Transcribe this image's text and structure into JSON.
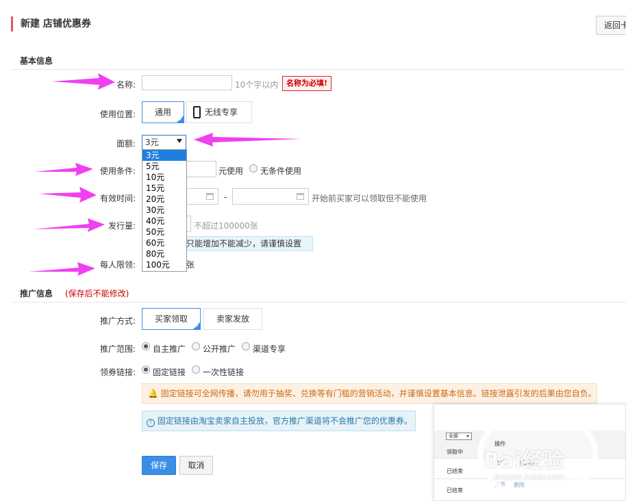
{
  "header": {
    "title": "新建 店铺优惠券",
    "back_label": "返回卡"
  },
  "basic_section": {
    "title": "基本信息"
  },
  "name_field": {
    "label": "名称:",
    "value": "",
    "hint": "10个字以内",
    "error": "名称为必填!"
  },
  "location_field": {
    "label": "使用位置:",
    "options": [
      "通用",
      "无线专享"
    ]
  },
  "amount_field": {
    "label": "面额:",
    "selected": "3元",
    "options": [
      "3元",
      "5元",
      "10元",
      "15元",
      "20元",
      "30元",
      "40元",
      "50元",
      "60元",
      "80元",
      "100元"
    ]
  },
  "condition_field": {
    "label": "使用条件:",
    "unit": "元使用",
    "no_condition": "无条件使用"
  },
  "validity_field": {
    "label": "有效时间:",
    "separator": "-",
    "hint": "开始前买家可以领取但不能使用"
  },
  "quantity_field": {
    "label": "发行量:",
    "hint": "不超过100000张",
    "note": "时只能增加不能减少，请谨慎设置"
  },
  "limit_field": {
    "label": "每人限领:",
    "unit": "张"
  },
  "promo_section": {
    "title": "推广信息",
    "note": "(保存后不能修改)"
  },
  "promo_method": {
    "label": "推广方式:",
    "options": [
      "买家领取",
      "卖家发放"
    ]
  },
  "promo_scope": {
    "label": "推广范围:",
    "options": [
      "自主推广",
      "公开推广",
      "渠道专享"
    ]
  },
  "coupon_link": {
    "label": "领券链接:",
    "options": [
      "固定链接",
      "一次性链接"
    ]
  },
  "notices": {
    "warning": "固定链接可全网传播，请勿用于抽奖、兑换等有门槛的营销活动，并谨慎设置基本信息。链接泄露引发的后果由您自负。",
    "info": "固定链接由淘宝卖家自主投放，官方推广渠道将不会推广您的优惠券。"
  },
  "actions": {
    "save": "保存",
    "cancel": "取消"
  },
  "preview": {
    "filter": "全部",
    "col_header": "操作",
    "rows": [
      {
        "status": "领取中",
        "actions": [
          "管理",
          "查看链接"
        ]
      },
      {
        "status": "已结束",
        "actions": [
          "查看",
          "删除"
        ]
      },
      {
        "status": "已结束",
        "actions": [
          "查看",
          "删除"
        ]
      }
    ]
  },
  "watermark": {
    "brand": "Bai经验",
    "url": "jingyan.baidu.com"
  },
  "colors": {
    "accent": "#3a8ee6",
    "arrow": "#f040f0",
    "error": "#e02020",
    "title_bar": "#e05a5a"
  }
}
